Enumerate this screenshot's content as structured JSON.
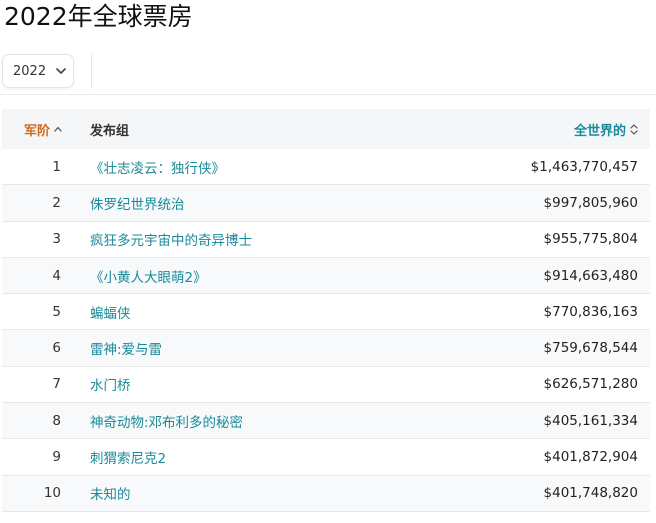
{
  "page": {
    "title": "2022年全球票房"
  },
  "toolbar": {
    "year_selected": "2022",
    "chevron_icon": "chevron-down-icon"
  },
  "table": {
    "headers": {
      "rank": "军阶",
      "publisher": "发布组",
      "gross": "全世界的"
    },
    "rank_sort_icon": "caret-up-icon",
    "gross_sort_icon": "sort-updown-icon",
    "rows": [
      {
        "rank": "1",
        "title": "《壮志凌云：独行侠》",
        "gross": "$1,463,770,457"
      },
      {
        "rank": "2",
        "title": "侏罗纪世界统治",
        "gross": "$997,805,960"
      },
      {
        "rank": "3",
        "title": "疯狂多元宇宙中的奇异博士",
        "gross": "$955,775,804"
      },
      {
        "rank": "4",
        "title": "《小黄人大眼萌2》",
        "gross": "$914,663,480"
      },
      {
        "rank": "5",
        "title": "蝙蝠侠",
        "gross": "$770,836,163"
      },
      {
        "rank": "6",
        "title": "雷神:爱与雷",
        "gross": "$759,678,544"
      },
      {
        "rank": "7",
        "title": "水门桥",
        "gross": "$626,571,280"
      },
      {
        "rank": "8",
        "title": "神奇动物:邓布利多的秘密",
        "gross": "$405,161,334"
      },
      {
        "rank": "9",
        "title": "刺猬索尼克2",
        "gross": "$401,872,904"
      },
      {
        "rank": "10",
        "title": "未知的",
        "gross": "$401,748,820"
      }
    ]
  },
  "colors": {
    "link": "#1a8a9a",
    "rank_header": "#d2691e",
    "header_bg": "#f4f6f8",
    "zebra_bg": "#f7f9fa"
  }
}
